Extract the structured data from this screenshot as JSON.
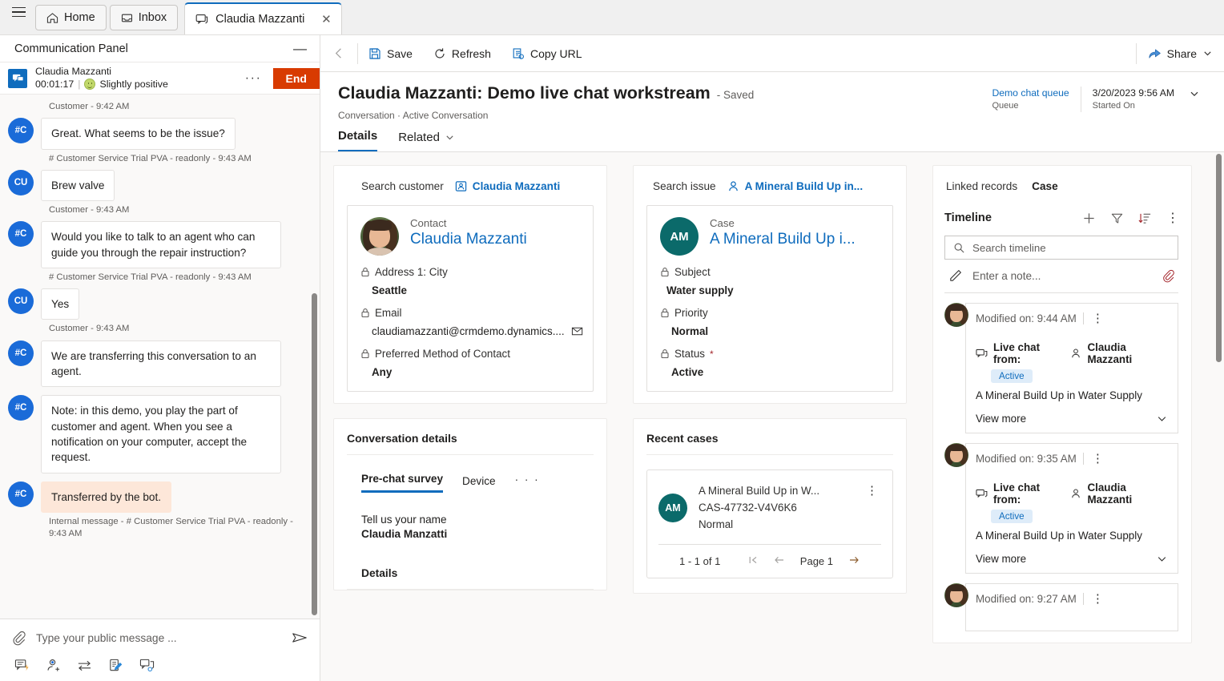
{
  "tabbar": {
    "menu_icon": "hamburger-icon",
    "tabs": [
      {
        "label": "Home",
        "icon": "home-icon"
      },
      {
        "label": "Inbox",
        "icon": "inbox-icon"
      },
      {
        "label": "Claudia Mazzanti",
        "icon": "chat-icon",
        "close": "✕"
      }
    ]
  },
  "communication_panel": {
    "title": "Communication Panel",
    "minimize": "—",
    "conversation": {
      "customer_name": "Claudia Mazzanti",
      "timer": "00:01:17",
      "separator": "|",
      "sentiment": "Slightly positive",
      "more": "···",
      "end_label": "End"
    },
    "messages": [
      {
        "type": "stamp",
        "text": "Customer - 9:42 AM"
      },
      {
        "type": "bubble",
        "avatar": "#C",
        "text": "Great. What seems to be the issue?",
        "stamp": "# Customer Service Trial PVA - readonly - 9:43 AM"
      },
      {
        "type": "bubble",
        "avatar": "CU",
        "text": "Brew valve",
        "stamp": "Customer - 9:43 AM"
      },
      {
        "type": "bubble",
        "avatar": "#C",
        "text": "Would you like to talk to an agent who can guide you through the repair instruction?",
        "stamp": "# Customer Service Trial PVA - readonly - 9:43 AM"
      },
      {
        "type": "bubble",
        "avatar": "CU",
        "text": "Yes",
        "stamp": "Customer - 9:43 AM"
      },
      {
        "type": "bubble",
        "avatar": "#C",
        "text": "We are transferring this conversation to an agent.",
        "stamp": ""
      },
      {
        "type": "bubble",
        "avatar": "#C",
        "text": "Note: in this demo, you play the part of customer and agent. When you see a notification on your computer, accept the request.",
        "stamp": ""
      },
      {
        "type": "bubble",
        "avatar": "#C",
        "text": "Transferred by the bot.",
        "warn": true,
        "stamp": "Internal message - # Customer Service Trial PVA - readonly - 9:43 AM"
      }
    ],
    "composer": {
      "placeholder": "Type your public message ...",
      "attach_icon": "paperclip-icon",
      "send_icon": "send-icon"
    },
    "tools": [
      {
        "name": "quick-replies-icon"
      },
      {
        "name": "add-agent-icon"
      },
      {
        "name": "transfer-icon"
      },
      {
        "name": "notes-icon"
      },
      {
        "name": "consult-icon"
      }
    ]
  },
  "command_bar": {
    "back_icon": "back-arrow-icon",
    "save": "Save",
    "refresh": "Refresh",
    "copy_url": "Copy URL",
    "share": "Share"
  },
  "header": {
    "title": "Claudia Mazzanti: Demo live chat workstream",
    "saved": "- Saved",
    "breadcrumb": "Conversation · Active Conversation",
    "meta": [
      {
        "value": "Demo chat queue",
        "label": "Queue",
        "link": true
      },
      {
        "value": "3/20/2023 9:56 AM",
        "label": "Started On",
        "link": false
      }
    ]
  },
  "tabs2": [
    {
      "label": "Details",
      "active": true
    },
    {
      "label": "Related",
      "active": false,
      "chevron": true
    }
  ],
  "customer": {
    "search_label": "Search customer",
    "search_value": "Claudia Mazzanti",
    "card": {
      "kind": "Contact",
      "name": "Claudia Mazzanti",
      "fields": [
        {
          "label": "Address 1: City",
          "value": "Seattle"
        },
        {
          "label": "Email",
          "value": "claudiamazzanti@crmdemo.dynamics....",
          "action_icon": "email-icon"
        },
        {
          "label": "Preferred Method of Contact",
          "value": "Any"
        }
      ]
    }
  },
  "issue": {
    "search_label": "Search issue",
    "search_value": "A Mineral Build Up in...",
    "card": {
      "kind": "Case",
      "initials": "AM",
      "name": "A Mineral Build Up i...",
      "fields": [
        {
          "label": "Subject",
          "value": "Water supply"
        },
        {
          "label": "Priority",
          "value": "Normal"
        },
        {
          "label": "Status",
          "required": "*",
          "value": "Active"
        }
      ]
    }
  },
  "conversation_details": {
    "heading": "Conversation details",
    "tabs": [
      {
        "label": "Pre-chat survey",
        "active": true
      },
      {
        "label": "Device",
        "active": false
      },
      {
        "label": "· · ·",
        "active": false,
        "dots": true
      }
    ],
    "survey": {
      "question": "Tell us your name",
      "answer": "Claudia Manzatti"
    },
    "details_heading": "Details"
  },
  "recent_cases": {
    "heading": "Recent cases",
    "items": [
      {
        "initials": "AM",
        "title": "A Mineral Build Up in W...",
        "number": "CAS-47732-V4V6K6",
        "priority": "Normal"
      }
    ],
    "pager": {
      "count": "1 - 1 of 1",
      "first": "⏮",
      "prev": "←",
      "page": "Page 1",
      "next": "→"
    }
  },
  "linked_records": {
    "label": "Linked records",
    "value": "Case"
  },
  "timeline": {
    "title": "Timeline",
    "actions": [
      {
        "name": "add-icon"
      },
      {
        "name": "filter-icon"
      },
      {
        "name": "sort-icon"
      },
      {
        "name": "more-icon"
      }
    ],
    "search_placeholder": "Search timeline",
    "note_placeholder": "Enter a note...",
    "attach_icon": "paperclip-icon",
    "entries": [
      {
        "when": "Modified on: 9:44 AM",
        "from_label": "Live chat from:",
        "from_name": "Claudia Mazzanti",
        "badge": "Active",
        "desc": "A Mineral Build Up in Water Supply",
        "more": "View more"
      },
      {
        "when": "Modified on: 9:35 AM",
        "from_label": "Live chat from:",
        "from_name": "Claudia Mazzanti",
        "badge": "Active",
        "desc": "A Mineral Build Up in Water Supply",
        "more": "View more"
      },
      {
        "when": "Modified on: 9:27 AM",
        "from_label": "",
        "from_name": "",
        "badge": "",
        "desc": "",
        "more": ""
      }
    ]
  },
  "colors": {
    "accent": "#0f6cbd",
    "end_button": "#d83b01",
    "case_avatar": "#0b6a6a",
    "bot_avatar": "#1a6bd8",
    "warn_bubble": "#fde7d9",
    "badge_bg": "#deecf9"
  }
}
